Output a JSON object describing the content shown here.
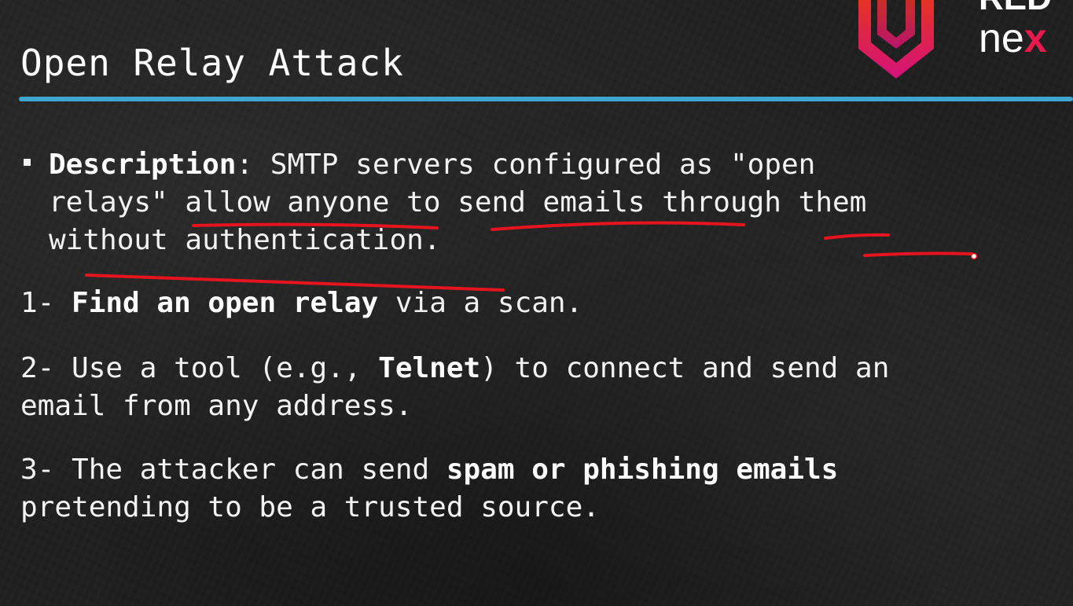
{
  "slide": {
    "title": "Open Relay Attack",
    "accent_color": "#3fa6cf",
    "annotation_color": "#e5141e"
  },
  "logo": {
    "top_text": "RED",
    "bottom_text": "ne",
    "bottom_accent": "x",
    "icon": "shield-logo-icon"
  },
  "description": {
    "bullet_icon": "square-bullet-icon",
    "label": "Description",
    "line1_rest": ": SMTP servers configured as \"open",
    "line2": "relays\" allow anyone to send emails through them",
    "line3": "without authentication."
  },
  "steps": [
    {
      "prefix": "1- ",
      "bold": "Find an open relay",
      "rest": " via a scan."
    },
    {
      "prefix": "2- Use a tool (e.g., ",
      "bold": "Telnet",
      "rest": ") to connect and send an",
      "line2": "email from any address."
    },
    {
      "prefix": "3- The attacker can send ",
      "bold": "spam or phishing emails",
      "rest": "",
      "line2": "pretending to be a trusted source."
    }
  ]
}
